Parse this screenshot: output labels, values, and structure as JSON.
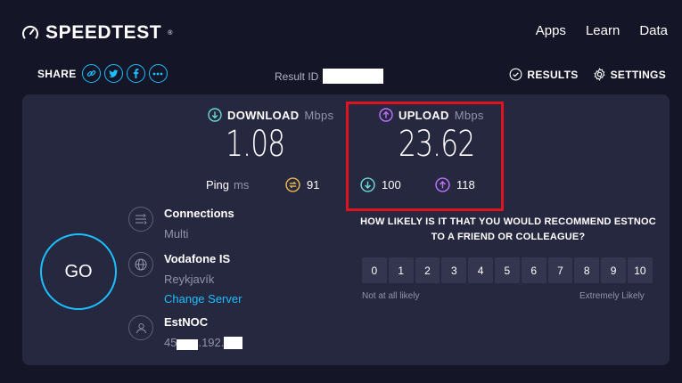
{
  "brand": {
    "name": "SPEEDTEST",
    "tm": "®",
    "accent": "#1cbfff"
  },
  "topnav": [
    {
      "label": "Apps"
    },
    {
      "label": "Learn"
    },
    {
      "label": "Data"
    }
  ],
  "share": {
    "label": "SHARE",
    "buttons": [
      {
        "icon": "link-icon"
      },
      {
        "icon": "twitter-icon"
      },
      {
        "icon": "facebook-icon"
      },
      {
        "icon": "more-icon"
      }
    ]
  },
  "result_id": {
    "label": "Result ID"
  },
  "toolbar": {
    "results_label": "RESULTS",
    "settings_label": "SETTINGS"
  },
  "download": {
    "label": "DOWNLOAD",
    "unit": "Mbps",
    "value": "1.08",
    "color": "#6ad8d2"
  },
  "upload": {
    "label": "UPLOAD",
    "unit": "Mbps",
    "value": "23.62",
    "color": "#bf71ff"
  },
  "ping": {
    "label": "Ping",
    "unit": "ms",
    "idle": "91",
    "download": "100",
    "upload": "118",
    "idle_color": "#e6b94f"
  },
  "go_label": "GO",
  "connections": {
    "title": "Connections",
    "value": "Multi"
  },
  "isp": {
    "title": "Vodafone IS",
    "location": "Reykjavík",
    "change_server": "Change Server"
  },
  "host": {
    "title": "EstNOC",
    "ip_start": "45",
    "ip_mid": ".192."
  },
  "nps": {
    "question": "HOW LIKELY IS IT THAT YOU WOULD RECOMMEND ESTNOC TO A FRIEND OR COLLEAGUE?",
    "scale": [
      "0",
      "1",
      "2",
      "3",
      "4",
      "5",
      "6",
      "7",
      "8",
      "9",
      "10"
    ],
    "low_label": "Not at all likely",
    "high_label": "Extremely Likely"
  }
}
